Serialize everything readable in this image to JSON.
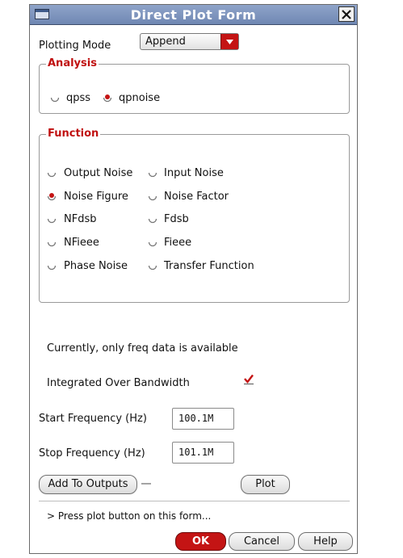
{
  "window": {
    "title": "Direct Plot Form"
  },
  "plotting_mode": {
    "label": "Plotting Mode",
    "value": "Append"
  },
  "analysis": {
    "title": "Analysis",
    "options": [
      {
        "label": "qpss",
        "selected": false
      },
      {
        "label": "qpnoise",
        "selected": true
      }
    ]
  },
  "function": {
    "title": "Function",
    "options": [
      {
        "label": "Output Noise",
        "selected": false
      },
      {
        "label": "Input Noise",
        "selected": false
      },
      {
        "label": "Noise Figure",
        "selected": true
      },
      {
        "label": "Noise Factor",
        "selected": false
      },
      {
        "label": "NFdsb",
        "selected": false
      },
      {
        "label": "Fdsb",
        "selected": false
      },
      {
        "label": "NFieee",
        "selected": false
      },
      {
        "label": "Fieee",
        "selected": false
      },
      {
        "label": "Phase Noise",
        "selected": false
      },
      {
        "label": "Transfer Function",
        "selected": false
      }
    ]
  },
  "info_text": "Currently, only freq data is available",
  "integrated": {
    "label": "Integrated Over Bandwidth",
    "checked": true
  },
  "start_freq": {
    "label": "Start Frequency (Hz)",
    "value": "100.1M"
  },
  "stop_freq": {
    "label": "Stop Frequency (Hz)",
    "value": "101.1M"
  },
  "buttons": {
    "add_to_outputs": "Add To Outputs",
    "plot": "Plot",
    "ok": "OK",
    "cancel": "Cancel",
    "help": "Help"
  },
  "status_text": "> Press plot button on this form...",
  "colors": {
    "accent_red": "#c41414",
    "titlebar": "#7f95bf"
  }
}
